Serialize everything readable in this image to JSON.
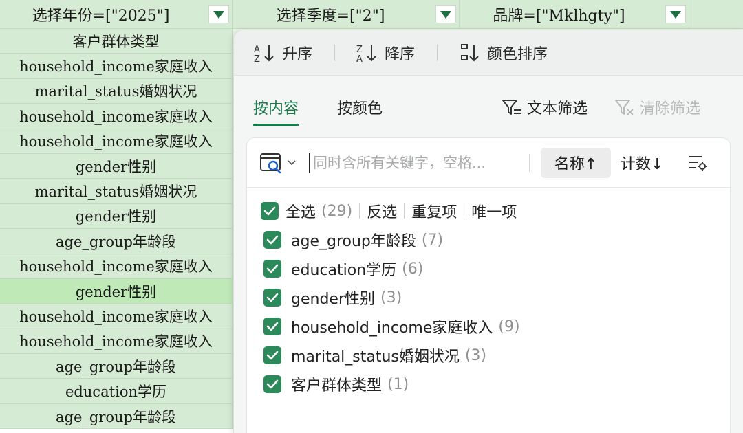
{
  "filters": [
    {
      "label": "选择年份=[\"2025\"]"
    },
    {
      "label": "选择季度=[\"2\"]"
    },
    {
      "label": "品牌=[\"Mklhgty\"]"
    }
  ],
  "column_cells": [
    "客户群体类型",
    "household_income家庭收入",
    "marital_status婚姻状况",
    "household_income家庭收入",
    "household_income家庭收入",
    "gender性别",
    "marital_status婚姻状况",
    "gender性别",
    "age_group年龄段",
    "household_income家庭收入",
    "gender性别",
    "household_income家庭收入",
    "household_income家庭收入",
    "age_group年龄段",
    "education学历",
    "age_group年龄段"
  ],
  "selected_row_index": 10,
  "sort": {
    "asc": "升序",
    "desc": "降序",
    "by_color": "颜色排序"
  },
  "tabs": {
    "by_content": "按内容",
    "by_color": "按颜色",
    "text_filter": "文本筛选",
    "clear_filter": "清除筛选"
  },
  "search": {
    "placeholder": "同时含所有关键字，空格...",
    "value": "",
    "sort_name": "名称↑",
    "sort_count": "计数↓"
  },
  "list_header": {
    "select_all": "全选",
    "select_all_count": "(29)",
    "invert": "反选",
    "duplicates": "重复项",
    "unique": "唯一项"
  },
  "items": [
    {
      "label": "age_group年龄段",
      "count": "(7)",
      "checked": true
    },
    {
      "label": "education学历",
      "count": "(6)",
      "checked": true
    },
    {
      "label": "gender性别",
      "count": "(3)",
      "checked": true
    },
    {
      "label": "household_income家庭收入",
      "count": "(9)",
      "checked": true
    },
    {
      "label": "marital_status婚姻状况",
      "count": "(3)",
      "checked": true
    },
    {
      "label": "客户群体类型",
      "count": "(1)",
      "checked": true
    }
  ],
  "colors": {
    "accent": "#1a7a4b",
    "checkbox": "#2c8a5a",
    "cell_bg": "#d6ebd3",
    "cell_selected": "#bfeab8"
  }
}
